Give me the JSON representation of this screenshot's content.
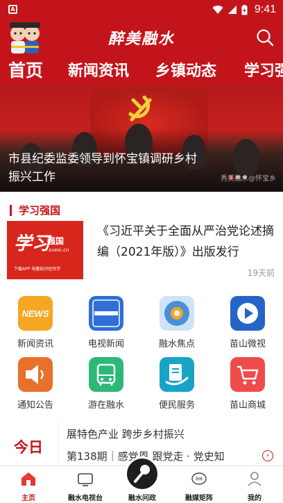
{
  "status_bar": {
    "time": "9:41",
    "app_badge": "A"
  },
  "header": {
    "logo_text": "醉美融水"
  },
  "tabs": [
    "首页",
    "新闻资讯",
    "乡镇动态",
    "学习强国"
  ],
  "banner": {
    "caption": "市县纪委监委领导到怀宝镇调研乡村振兴工作",
    "watermark": "秀美融水@怀宝乡"
  },
  "section": {
    "title": "学习强国"
  },
  "feature": {
    "thumb_big": "学习",
    "thumb_small": "强国",
    "thumb_url": "xuexi.cn",
    "thumb_tag": "下载APP 海量知识任你学",
    "headline": "《习近平关于全面从严治党论述摘编（2021年版）》出版发行",
    "time_ago": "19天前"
  },
  "grid": [
    {
      "label": "新闻资讯",
      "icon": "news-icon",
      "color": "#f5a623"
    },
    {
      "label": "电视新闻",
      "icon": "tv-news-icon",
      "color": "#2f6fd6"
    },
    {
      "label": "融水焦点",
      "icon": "focus-icon",
      "color": "#4a8fd8"
    },
    {
      "label": "苗山微视",
      "icon": "video-play-icon",
      "color": "#2664c8"
    },
    {
      "label": "通知公告",
      "icon": "speaker-icon",
      "color": "#e8702a"
    },
    {
      "label": "游在融水",
      "icon": "bus-icon",
      "color": "#2db87a"
    },
    {
      "label": "便民服务",
      "icon": "service-icon",
      "color": "#19a3c6"
    },
    {
      "label": "苗山商城",
      "icon": "cart-icon",
      "color": "#ef4b4b"
    }
  ],
  "today": {
    "label": "今日",
    "line1": "展特色产业 跨步乡村振兴",
    "line2": "第138期｜感党恩 跟党走 · 党史知"
  },
  "bottom_nav": [
    {
      "label": "主页",
      "icon": "home-icon"
    },
    {
      "label": "融水电视台",
      "icon": "tv-icon"
    },
    {
      "label": "融水问政",
      "icon": "microphone-icon"
    },
    {
      "label": "融媒矩阵",
      "icon": "matrix-icon"
    },
    {
      "label": "我的",
      "icon": "user-icon"
    }
  ],
  "colors": {
    "brand": "#c4141b"
  }
}
